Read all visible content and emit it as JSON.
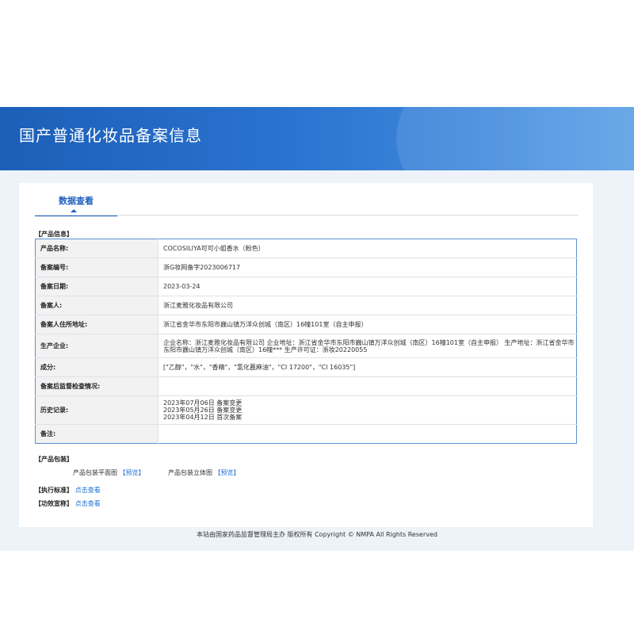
{
  "banner": {
    "title": "国产普通化妆品备案信息"
  },
  "tab": {
    "label": "数据查看"
  },
  "sections": {
    "product_info": "【产品信息】",
    "packaging": "【产品包装】",
    "standard": "【执行标准】",
    "efficacy": "【功效宣称】"
  },
  "info_rows": [
    {
      "key": "产品名称:",
      "value": "COCOSILIYA可可小姐香水（粉色）"
    },
    {
      "key": "备案编号:",
      "value": "浙G妆网备字2023006717"
    },
    {
      "key": "备案日期:",
      "value": "2023-03-24"
    },
    {
      "key": "备案人:",
      "value": "浙江麦雅化妆品有限公司"
    },
    {
      "key": "备案人住所地址:",
      "value": "浙江省金华市东阳市巍山镇万洋众创城（南区）16幢101室（自主申报）"
    },
    {
      "key": "生产企业:",
      "value": "企业名称：浙江麦雅化妆品有限公司 企业地址：浙江省金华市东阳市巍山镇万洋众创城（南区）16幢101室（自主申报） 生产地址：浙江省金华市东阳市巍山镇万洋众创城（南区）16幢*** 生产许可证：浙妆20220055"
    },
    {
      "key": "成分:",
      "value": "[\"乙醇\"，\"水\"，\"香精\"，\"氢化蓖麻油\"，\"CI 17200\"，\"CI 16035\"]"
    },
    {
      "key": "备案后监督检查情况:",
      "value": ""
    },
    {
      "key": "历史记录:",
      "value": "2023年07月06日 备案变更\n2023年05月26日 备案变更\n2023年04月12日 首次备案"
    },
    {
      "key": "备注:",
      "value": ""
    }
  ],
  "packaging": {
    "flat_label": "产品包装平面图",
    "solid_label": "产品包装立体图",
    "preview": "【预览】"
  },
  "links": {
    "standard": "点击查看",
    "efficacy": "点击查看"
  },
  "footer": {
    "text": "本站由国家药品监督管理局主办 版权所有 Copyright © NMPA All Rights Reserved"
  },
  "colors": {
    "banner": "#2a73cf",
    "link": "#1e6fd0",
    "table_border": "#5b8fd0"
  }
}
